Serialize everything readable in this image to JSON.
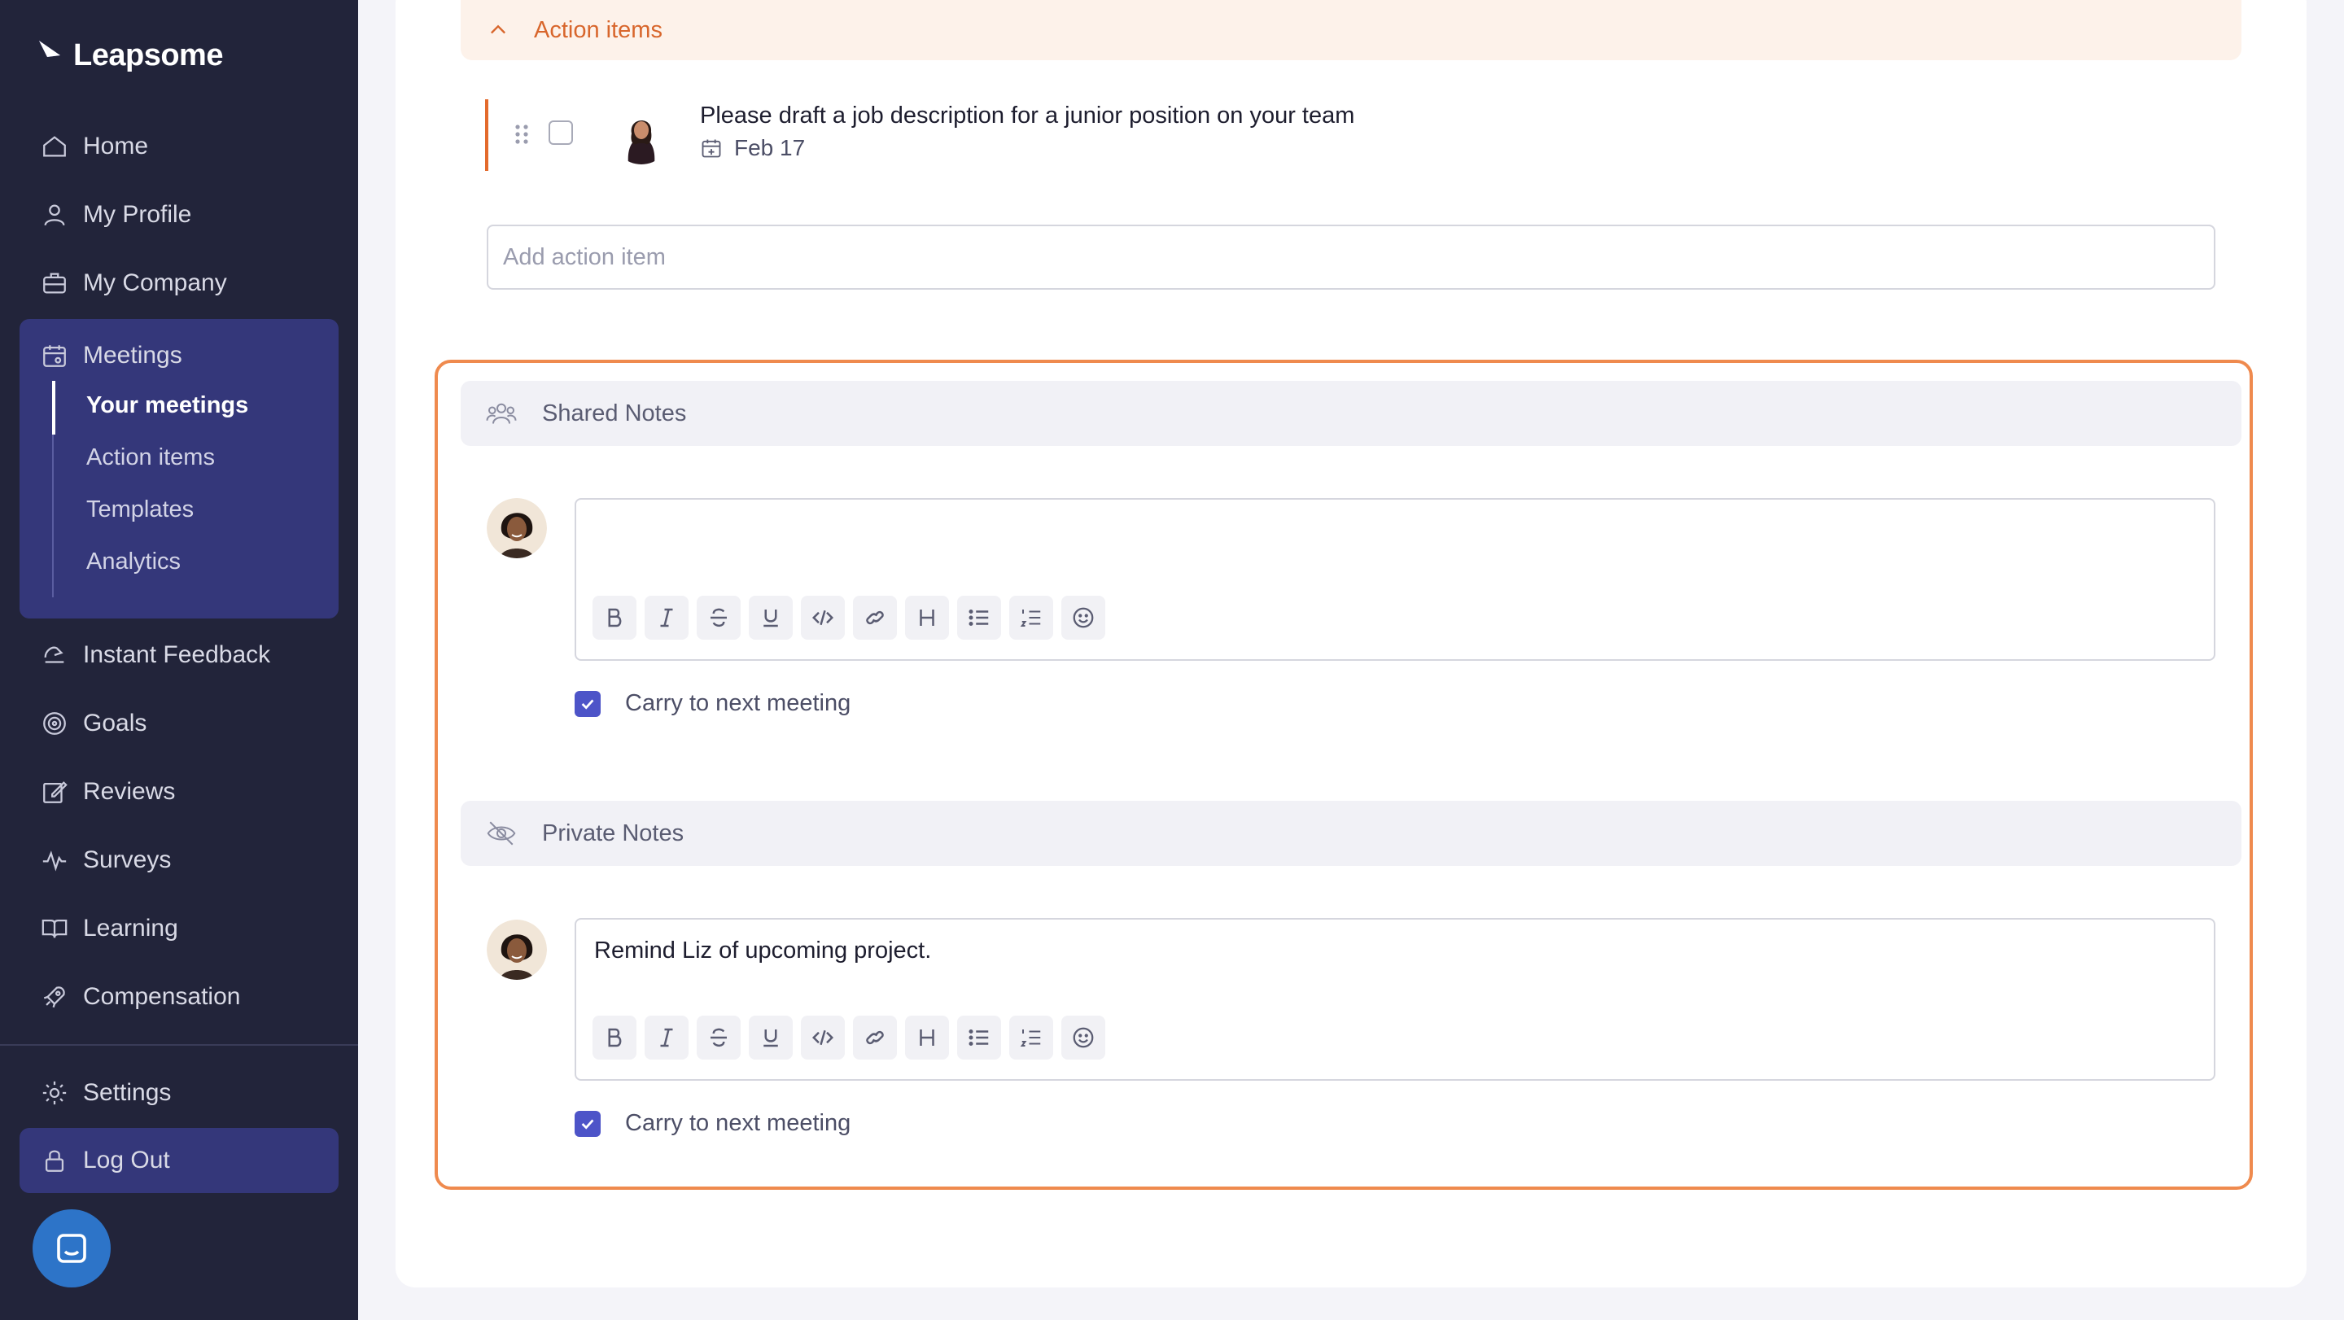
{
  "app": {
    "name": "Leapsome"
  },
  "sidebar": {
    "items": [
      {
        "label": "Home",
        "icon": "home-icon"
      },
      {
        "label": "My Profile",
        "icon": "user-icon"
      },
      {
        "label": "My Company",
        "icon": "briefcase-icon"
      },
      {
        "label": "Meetings",
        "icon": "meetings-icon"
      },
      {
        "label": "Instant Feedback",
        "icon": "feedback-icon"
      },
      {
        "label": "Goals",
        "icon": "target-icon"
      },
      {
        "label": "Reviews",
        "icon": "edit-icon"
      },
      {
        "label": "Surveys",
        "icon": "pulse-icon"
      },
      {
        "label": "Learning",
        "icon": "book-icon"
      },
      {
        "label": "Compensation",
        "icon": "rocket-icon"
      },
      {
        "label": "Settings",
        "icon": "gear-icon"
      }
    ],
    "meetings_sub": [
      {
        "label": "Your meetings",
        "active": true
      },
      {
        "label": "Action items",
        "active": false
      },
      {
        "label": "Templates",
        "active": false
      },
      {
        "label": "Analytics",
        "active": false
      }
    ],
    "logout_label": "Log Out"
  },
  "action_items": {
    "header": "Action items",
    "items": [
      {
        "title": "Please draft a job description for a junior position on your team",
        "date": "Feb 17",
        "checked": false
      }
    ],
    "add_placeholder": "Add action item"
  },
  "shared_notes": {
    "header": "Shared Notes",
    "content": "",
    "carry_label": "Carry to next meeting",
    "carry_checked": true
  },
  "private_notes": {
    "header": "Private Notes",
    "content": "Remind Liz of upcoming project.",
    "carry_label": "Carry to next meeting",
    "carry_checked": true
  },
  "colors": {
    "sidebar_bg": "#22243a",
    "active_group_bg": "#34377a",
    "accent_orange": "#e36a2c",
    "checkbox_blue": "#4d54c8"
  }
}
